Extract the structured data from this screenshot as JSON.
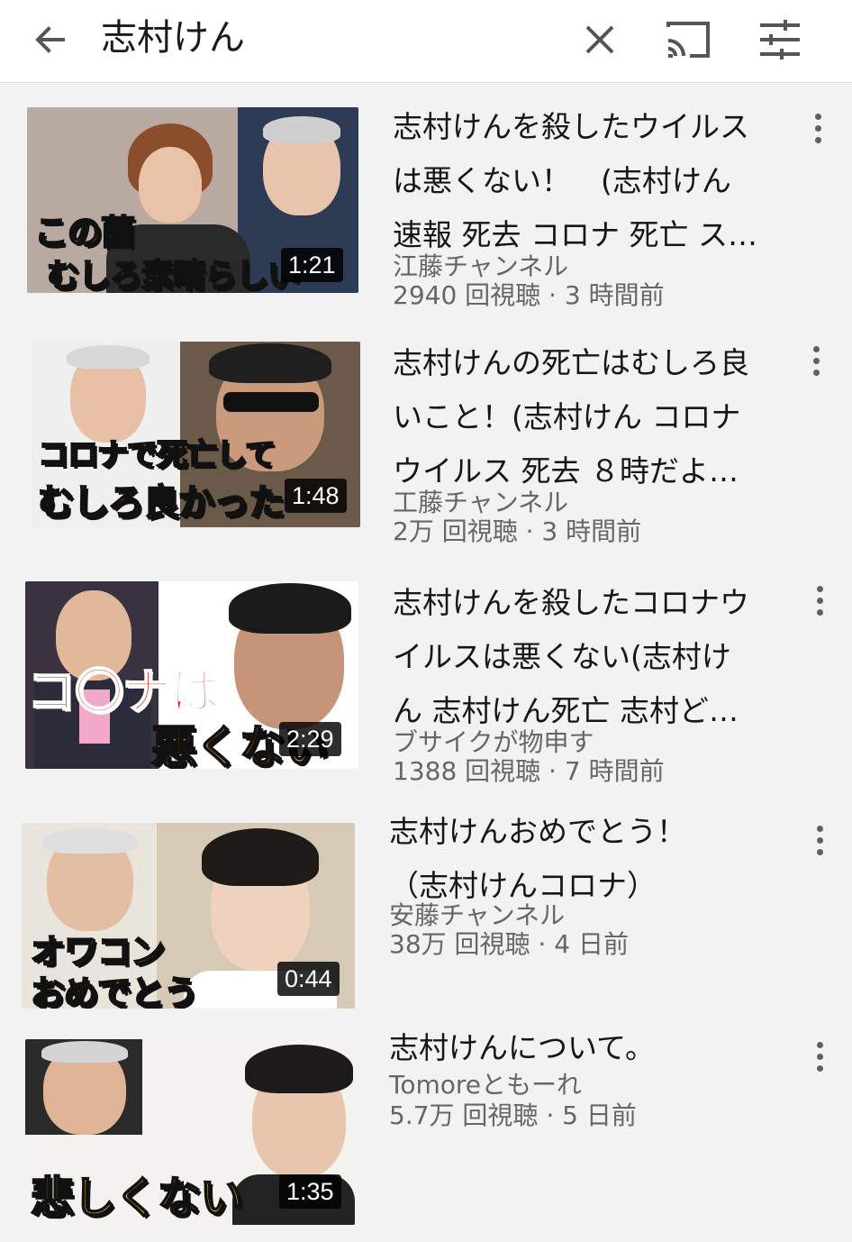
{
  "search": {
    "query": "志村けん",
    "back_icon": "arrow-back-icon",
    "clear_icon": "close-icon",
    "cast_icon": "cast-icon",
    "filter_icon": "filter-sliders-icon"
  },
  "videos": [
    {
      "title_lines": [
        "志村けんを殺したウイルス",
        "は悪くない！　(志村けん",
        "速報 死去 コロナ 死亡 ス…"
      ],
      "channel": "江藤チャンネル",
      "meta": "2940 回視聴 · 3 時間前",
      "duration": "1:21",
      "thumb_caption": [
        "この菌",
        "むしろ素晴らしい"
      ]
    },
    {
      "title_lines": [
        "志村けんの死亡はむしろ良",
        "いこと！(志村けん コロナ",
        "ウイルス 死去 ８時だよ…"
      ],
      "channel": "工藤チャンネル",
      "meta": "2万 回視聴 · 3 時間前",
      "duration": "1:48",
      "thumb_caption": [
        "コロナで死亡して",
        "むしろ良かった"
      ]
    },
    {
      "title_lines": [
        "志村けんを殺したコロナウ",
        "イルスは悪くない(志村け",
        "ん 志村けん死亡 志村ど…"
      ],
      "channel": "ブサイクが物申す",
      "meta": "1388 回視聴 · 7 時間前",
      "duration": "2:29",
      "thumb_caption": [
        "コ〇ナは",
        "悪くない"
      ]
    },
    {
      "title_lines": [
        "志村けんおめでとう！",
        "（志村けんコロナ）"
      ],
      "channel": "安藤チャンネル",
      "meta": "38万 回視聴 · 4 日前",
      "duration": "0:44",
      "thumb_caption": [
        "オワコン",
        "おめでとう"
      ]
    },
    {
      "title_lines": [
        "志村けんについて。"
      ],
      "channel": "Tomoreともーれ",
      "meta": "5.7万 回視聴 · 5 日前",
      "duration": "1:35",
      "thumb_caption": [
        "悲しくない"
      ]
    }
  ],
  "more_icon": "more-vert-icon",
  "colors": {
    "caption_yellow": "#f7d21a",
    "caption_red": "#e8321e",
    "caption_orange": "#f28c1e",
    "text_secondary": "#666666"
  }
}
